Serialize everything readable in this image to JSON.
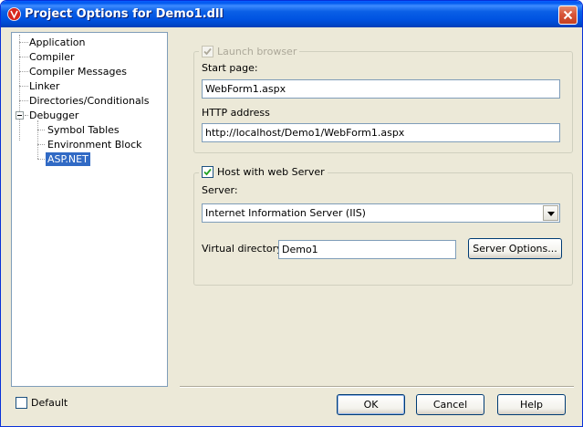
{
  "window": {
    "title": "Project Options for Demo1.dll"
  },
  "tree": {
    "items": [
      {
        "label": "Application"
      },
      {
        "label": "Compiler"
      },
      {
        "label": "Compiler Messages"
      },
      {
        "label": "Linker"
      },
      {
        "label": "Directories/Conditionals"
      },
      {
        "label": "Debugger"
      },
      {
        "label": "Symbol Tables"
      },
      {
        "label": "Environment Block"
      },
      {
        "label": "ASP.NET",
        "selected": true
      }
    ]
  },
  "launch": {
    "checkbox_label": "Launch browser",
    "checked": true,
    "enabled": false,
    "start_page_label": "Start page:",
    "start_page_value": "WebForm1.aspx",
    "http_address_label": "HTTP address",
    "http_address_value": "http://localhost/Demo1/WebForm1.aspx"
  },
  "host": {
    "checkbox_label": "Host with web Server",
    "checked": true,
    "server_label": "Server:",
    "server_value": "Internet Information Server (IIS)",
    "virtual_dir_label": "Virtual directory:",
    "virtual_dir_value": "Demo1",
    "server_options_label": "Server Options..."
  },
  "footer": {
    "default_label": "Default",
    "default_checked": false,
    "ok_label": "OK",
    "cancel_label": "Cancel",
    "help_label": "Help"
  },
  "colors": {
    "titlebar": "#0a5fe6",
    "selection": "#316ac5",
    "dialog_bg": "#ece9d8"
  }
}
